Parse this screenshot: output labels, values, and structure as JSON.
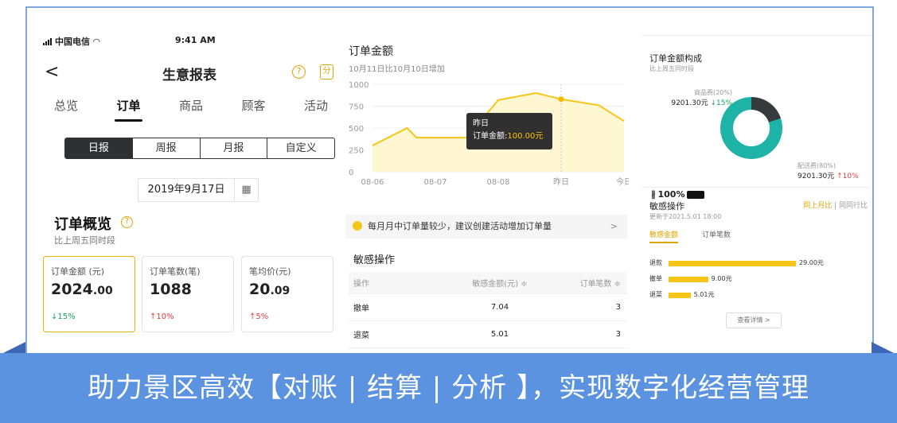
{
  "phone": {
    "status": {
      "carrier": "中国电信",
      "time": "9:41 AM",
      "battery": "100%"
    },
    "nav": {
      "back": "<",
      "title": "生意报表",
      "help": "?",
      "share": "分"
    },
    "tabs": [
      "总览",
      "订单",
      "商品",
      "顾客",
      "活动"
    ],
    "active_tab": "订单",
    "periods": [
      "日报",
      "周报",
      "月报",
      "自定义"
    ],
    "date": "2019年9月17日",
    "overview": {
      "title": "订单概览",
      "help": "?",
      "subtitle": "比上周五同时段",
      "cards": [
        {
          "label": "订单金额 (元)",
          "value_int": "2024",
          "value_dec": ".00",
          "change": "↓15%",
          "color": "#1aa35c"
        },
        {
          "label": "订单笔数(笔)",
          "value_int": "1088",
          "value_dec": "",
          "change": "↑10%",
          "color": "#e23c3c"
        },
        {
          "label": "笔均价(元)",
          "value_int": "20",
          "value_dec": ".09",
          "change": "↑5%",
          "color": "#e23c3c"
        }
      ]
    }
  },
  "middle": {
    "title": "订单金额",
    "subtitle": "10月11日比10月10日增加",
    "tooltip": {
      "label": "昨日",
      "key": "订单金额:",
      "value": "100.00元"
    },
    "notice": "每月月中订单量较少，建议创建活动增加订单量",
    "notice_arrow": ">",
    "sensitive_title": "敏感操作",
    "table": {
      "headers": [
        "操作",
        "敏感金额(元) ≑",
        "订单笔数 ≑"
      ],
      "rows": [
        [
          "撤单",
          "7.04",
          "3"
        ],
        [
          "退菜",
          "5.01",
          "3"
        ]
      ]
    }
  },
  "chart_data": [
    {
      "type": "area",
      "x": [
        "08-06",
        "08-07",
        "08-08",
        "昨日",
        "今日"
      ],
      "y_ticks": [
        "1000",
        "750",
        "500",
        "250",
        "0"
      ],
      "ylim": [
        0,
        1000
      ],
      "series": [
        {
          "points": [
            [
              0,
              300
            ],
            [
              0.55,
              500
            ],
            [
              0.7,
              390
            ],
            [
              1.0,
              390
            ],
            [
              1.5,
              390
            ],
            [
              2.0,
              820
            ],
            [
              2.6,
              900
            ],
            [
              3.0,
              830
            ],
            [
              3.6,
              760
            ],
            [
              4.0,
              580
            ]
          ]
        }
      ],
      "highlight_x": "昨日",
      "accent": "#f5c518"
    },
    {
      "type": "pie",
      "title": "订单金额构成",
      "subtitle": "比上周五同时段",
      "slices": [
        {
          "name": "商品费(20%)",
          "value": 20,
          "amount": "9201.30元",
          "change": "↓15%",
          "change_color": "#1aa35c",
          "color": "#353a3d"
        },
        {
          "name": "配送费(80%)",
          "value": 80,
          "amount": "9201.30元",
          "change": "↑10%",
          "change_color": "#e23c3c",
          "color": "#1db3a6"
        }
      ]
    },
    {
      "type": "bar",
      "title": "敏感操作",
      "subtitle": "更新于2021.5.01 18:00",
      "compare": [
        "同上月比",
        "同同行比"
      ],
      "tabs": [
        "敏感金额",
        "订单笔数"
      ],
      "categories": [
        "退款",
        "撤单",
        "退菜"
      ],
      "values": [
        29.0,
        9.0,
        5.01
      ],
      "value_labels": [
        "29.00元",
        "9.00元",
        "5.01元"
      ],
      "more": "查看详情 >"
    }
  ],
  "banner": {
    "text": "助力景区高效【对账 | 结算 | 分析 】，实现数字化经营管理"
  }
}
